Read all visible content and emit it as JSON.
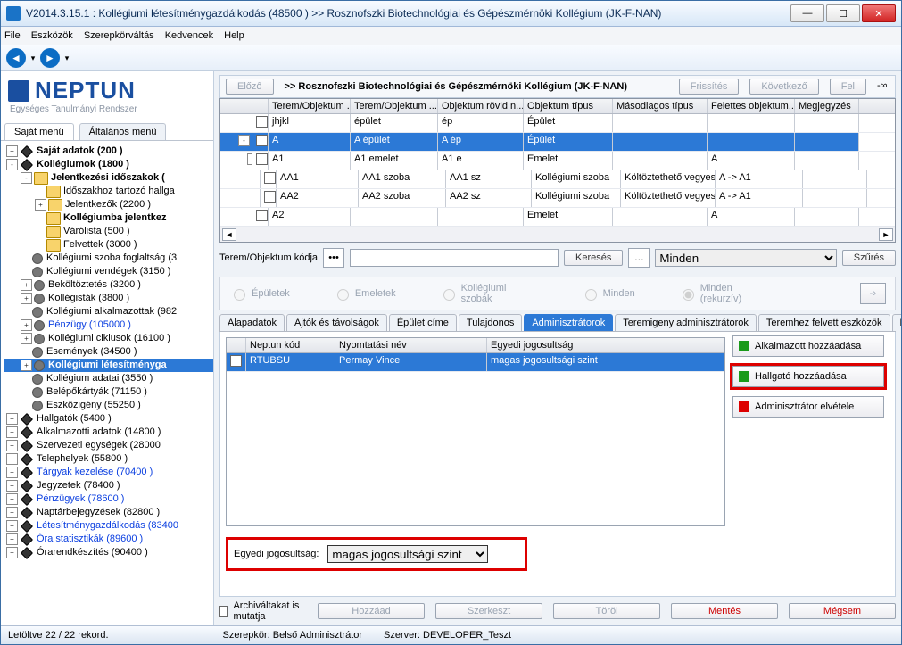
{
  "window": {
    "title": "V2014.3.15.1 : Kollégiumi létesítménygazdálkodás (48500  )  >> Rosznofszki Biotechnológiai és Gépészmérnöki Kollégium (JK-F-NAN)"
  },
  "menu": {
    "file": "File",
    "tools": "Eszközök",
    "role": "Szerepkörváltás",
    "fav": "Kedvencek",
    "help": "Help"
  },
  "logo": {
    "main": "NEPTUN",
    "sub": "Egységes Tanulmányi Rendszer"
  },
  "left_tabs": {
    "own": "Saját menü",
    "general": "Általános menü"
  },
  "tree": [
    {
      "indent": 0,
      "exp": "+",
      "icon": "diamond",
      "text": "Saját adatok (200  )",
      "bold": true
    },
    {
      "indent": 0,
      "exp": "-",
      "icon": "diamond",
      "text": "Kollégiumok (1800  )",
      "bold": true
    },
    {
      "indent": 1,
      "exp": "-",
      "icon": "folder",
      "text": "Jelentkezési időszakok (",
      "bold": true
    },
    {
      "indent": 2,
      "exp": " ",
      "icon": "folder",
      "text": "Időszakhoz tartozó hallga"
    },
    {
      "indent": 2,
      "exp": "+",
      "icon": "folder",
      "text": "Jelentkezők (2200  )"
    },
    {
      "indent": 2,
      "exp": " ",
      "icon": "folder",
      "text": "Kollégiumba jelentkez",
      "bold": true
    },
    {
      "indent": 2,
      "exp": " ",
      "icon": "folder",
      "text": "Várólista (500  )"
    },
    {
      "indent": 2,
      "exp": " ",
      "icon": "folder",
      "text": "Felvettek (3000  )"
    },
    {
      "indent": 1,
      "exp": " ",
      "icon": "gear",
      "text": "Kollégiumi szoba foglaltság (3"
    },
    {
      "indent": 1,
      "exp": " ",
      "icon": "gear",
      "text": "Kollégiumi vendégek (3150  )"
    },
    {
      "indent": 1,
      "exp": "+",
      "icon": "gear",
      "text": "Beköltöztetés (3200  )"
    },
    {
      "indent": 1,
      "exp": "+",
      "icon": "gear",
      "text": "Kollégisták (3800  )"
    },
    {
      "indent": 1,
      "exp": " ",
      "icon": "gear",
      "text": "Kollégiumi alkalmazottak (982"
    },
    {
      "indent": 1,
      "exp": "+",
      "icon": "gear",
      "text": "Pénzügy (105000  )",
      "cls": "link"
    },
    {
      "indent": 1,
      "exp": "+",
      "icon": "gear",
      "text": "Kollégiumi ciklusok (16100  )"
    },
    {
      "indent": 1,
      "exp": " ",
      "icon": "gear",
      "text": "Események (34500  )"
    },
    {
      "indent": 1,
      "exp": "+",
      "icon": "gear",
      "text": "Kollégiumi létesítményga",
      "sel": true,
      "bold": true
    },
    {
      "indent": 1,
      "exp": " ",
      "icon": "gear",
      "text": "Kollégium adatai (3550  )"
    },
    {
      "indent": 1,
      "exp": " ",
      "icon": "gear",
      "text": "Belépőkártyák (71150  )"
    },
    {
      "indent": 1,
      "exp": " ",
      "icon": "gear",
      "text": "Eszközigény (55250  )"
    },
    {
      "indent": 0,
      "exp": "+",
      "icon": "diamond",
      "text": "Hallgatók (5400  )"
    },
    {
      "indent": 0,
      "exp": "+",
      "icon": "diamond",
      "text": "Alkalmazotti adatok (14800  )"
    },
    {
      "indent": 0,
      "exp": "+",
      "icon": "diamond",
      "text": "Szervezeti egységek (28000"
    },
    {
      "indent": 0,
      "exp": "+",
      "icon": "diamond",
      "text": "Telephelyek (55800  )"
    },
    {
      "indent": 0,
      "exp": "+",
      "icon": "diamond",
      "text": "Tárgyak kezelése (70400  )",
      "cls": "link"
    },
    {
      "indent": 0,
      "exp": "+",
      "icon": "diamond",
      "text": "Jegyzetek (78400  )"
    },
    {
      "indent": 0,
      "exp": "+",
      "icon": "diamond",
      "text": "Pénzügyek (78600  )",
      "cls": "link"
    },
    {
      "indent": 0,
      "exp": "+",
      "icon": "diamond",
      "text": "Naptárbejegyzések (82800  )"
    },
    {
      "indent": 0,
      "exp": "+",
      "icon": "diamond",
      "text": "Létesítménygazdálkodás (83400",
      "cls": "link"
    },
    {
      "indent": 0,
      "exp": "+",
      "icon": "diamond",
      "text": "Óra statisztikák (89600  )",
      "cls": "link"
    },
    {
      "indent": 0,
      "exp": "+",
      "icon": "diamond",
      "text": "Órarendkészítés (90400  )"
    }
  ],
  "header": {
    "prev": "Előző",
    "title": ">> Rosznofszki Biotechnológiai és Gépészmérnöki Kollégium (JK-F-NAN)",
    "refresh": "Frissítés",
    "next": "Következő",
    "up": "Fel"
  },
  "grid": {
    "cols": [
      "",
      "",
      "",
      "Terem/Objektum ...",
      "Terem/Objektum ...",
      "Objektum rövid n...",
      "Objektum típus",
      "Másodlagos típus",
      "Felettes objektum...",
      "Megjegyzés"
    ],
    "rows": [
      {
        "exp": "",
        "chk": true,
        "cells": [
          "jhjkl",
          "épület",
          "ép",
          "Épület",
          "",
          "",
          ""
        ]
      },
      {
        "exp": "-",
        "chk": true,
        "cells": [
          "A",
          "A épület",
          "A ép",
          "Épület",
          "",
          "",
          ""
        ],
        "selected": true
      },
      {
        "exp": "-",
        "chk": true,
        "cells": [
          "A1",
          "A1 emelet",
          "A1 e",
          "Emelet",
          "",
          "A",
          ""
        ],
        "indent": 1
      },
      {
        "exp": "",
        "chk": true,
        "cells": [
          "AA1",
          "AA1 szoba",
          "AA1 sz",
          "Kollégiumi szoba",
          "Költöztethető vegyes",
          "A -> A1",
          ""
        ],
        "indent": 2
      },
      {
        "exp": "",
        "chk": true,
        "cells": [
          "AA2",
          "AA2 szoba",
          "AA2 sz",
          "Kollégiumi szoba",
          "Költöztethető vegyes",
          "A -> A1",
          ""
        ],
        "indent": 2
      },
      {
        "exp": "",
        "chk": true,
        "cells": [
          "A2",
          "",
          "",
          "Emelet",
          "",
          "A",
          ""
        ],
        "indent": 1
      }
    ]
  },
  "search": {
    "label": "Terem/Objektum kódja",
    "btn": "Keresés",
    "filter_sel": "Minden",
    "filter_btn": "Szűrés"
  },
  "radios": {
    "r1": "Épületek",
    "r2": "Emeletek",
    "r3": "Kollégiumi szobák",
    "r4": "Minden",
    "r5": "Minden (rekurzív)"
  },
  "inner_tabs": [
    "Alapadatok",
    "Ajtók és távolságok",
    "Épület címe",
    "Tulajdonos",
    "Adminisztrátorok",
    "Teremigeny adminisztrátorok",
    "Teremhez felvett eszközök",
    "Kiegé"
  ],
  "admin_grid": {
    "cols": [
      "",
      "Neptun kód",
      "Nyomtatási név",
      "Egyedi jogosultság"
    ],
    "row": {
      "code": "RTUBSU",
      "name": "Permay Vince",
      "priv": "magas jogosultsági szint"
    }
  },
  "actions": {
    "add_emp": "Alkalmazott hozzáadása",
    "add_stu": "Hallgató hozzáadása",
    "remove": "Adminisztrátor elvétele"
  },
  "priv": {
    "label": "Egyedi jogosultság:",
    "value": "magas jogosultsági szint"
  },
  "footer": {
    "archive": "Archiváltakat is mutatja",
    "add": "Hozzáad",
    "edit": "Szerkeszt",
    "del": "Töröl",
    "save": "Mentés",
    "cancel": "Mégsem"
  },
  "status": {
    "records": "Letöltve 22 / 22 rekord.",
    "role": "Szerepkör: Belső Adminisztrátor",
    "server": "Szerver: DEVELOPER_Teszt"
  }
}
